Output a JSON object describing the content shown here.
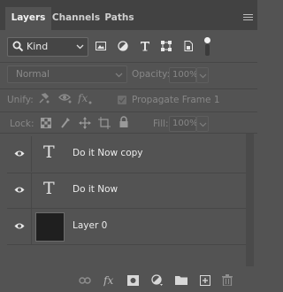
{
  "tabs": [
    {
      "label": "Layers",
      "active": true
    },
    {
      "label": "Channels",
      "active": false
    },
    {
      "label": "Paths",
      "active": false
    }
  ],
  "filter": {
    "kind_label": "Kind",
    "icons": [
      "pixel-layer-filter-icon",
      "adjustment-layer-filter-icon",
      "type-layer-filter-icon",
      "shape-layer-filter-icon",
      "smart-object-filter-icon"
    ]
  },
  "blend": {
    "mode": "Normal",
    "opacity_label": "Opacity:",
    "opacity_value": "100%"
  },
  "unify": {
    "label": "Unify:",
    "propagate_label": "Propagate Frame 1"
  },
  "lock": {
    "label": "Lock:",
    "fill_label": "Fill:",
    "fill_value": "100%"
  },
  "layers": [
    {
      "name": "Do it Now copy",
      "type": "text",
      "visible": true
    },
    {
      "name": "Do it Now",
      "type": "text",
      "visible": true
    },
    {
      "name": "Layer 0",
      "type": "pixel",
      "visible": true
    }
  ],
  "footer_icons": [
    "link-icon",
    "fx-icon",
    "mask-icon",
    "adjustment-icon",
    "folder-icon",
    "new-layer-icon",
    "trash-icon"
  ],
  "colors": {
    "panel": "#535353",
    "tabbar": "#424242",
    "text": "#ececec",
    "dim": "#878787"
  }
}
